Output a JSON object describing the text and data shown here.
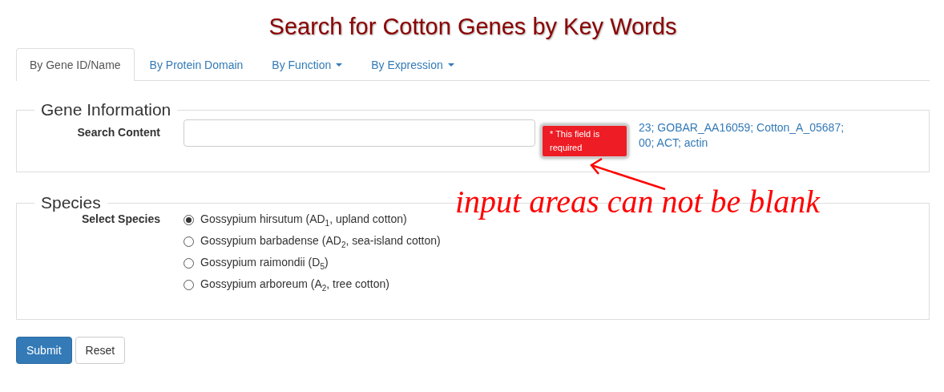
{
  "title": "Search for Cotton Genes by Key Words",
  "tabs": [
    {
      "label": "By Gene ID/Name",
      "selected": true,
      "dropdown": false
    },
    {
      "label": "By Protein Domain",
      "selected": false,
      "dropdown": false
    },
    {
      "label": "By Function",
      "selected": false,
      "dropdown": true
    },
    {
      "label": "By Expression",
      "selected": false,
      "dropdown": true
    }
  ],
  "gene_information": {
    "legend": "Gene Information",
    "label": "Search Content",
    "hint_lines": [
      "23; GOBAR_AA16059; Cotton_A_05687;",
      "00; ACT; actin"
    ],
    "error_tooltip": "* This field is required"
  },
  "annotation": "input areas can not be blank",
  "species": {
    "legend": "Species",
    "label": "Select Species",
    "options": [
      {
        "label": "Gossypium hirsutum (AD$_{1}$, upland cotton)",
        "selected": true
      },
      {
        "label": "Gossypium barbadense (AD$_{2}$, sea-island cotton)",
        "selected": false
      },
      {
        "label": "Gossypium raimondii (D$_{5}$)",
        "selected": false
      },
      {
        "label": "Gossypium arboreum (A$_{2}$, tree cotton)",
        "selected": false
      }
    ]
  },
  "buttons": [
    {
      "label": "Submit",
      "kind": "primary"
    },
    {
      "label": "Reset",
      "kind": "default"
    }
  ]
}
